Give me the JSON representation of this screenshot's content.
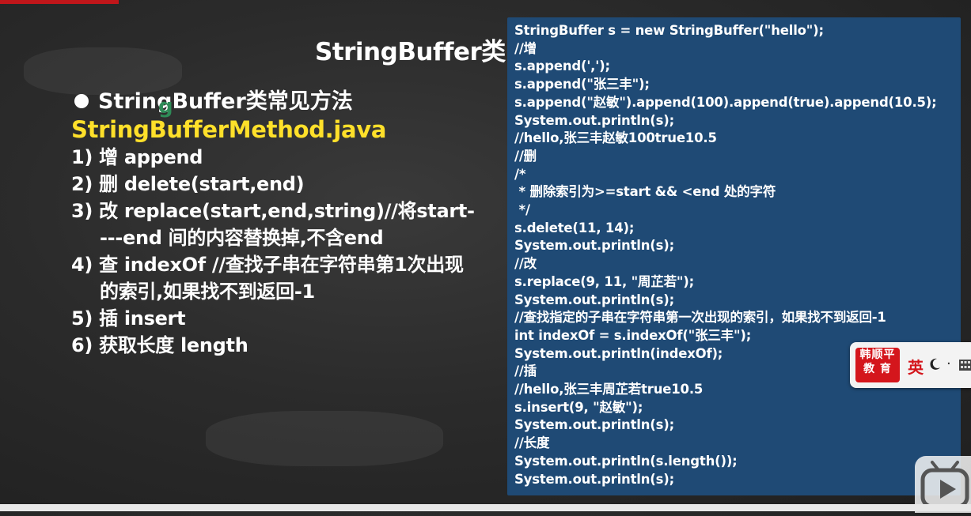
{
  "slide": {
    "title": "StringBuffer类",
    "bullet": "StringBuffer类常见方法",
    "filename": "StringBufferMethod.java",
    "methods": [
      "1) 增 append",
      "2) 删 delete(start,end)",
      "3) 改 replace(start,end,string)//将start----end 间的内容替换掉,不含end",
      "4) 查 indexOf //查找子串在字符串第1次出现的索引,如果找不到返回-1",
      "5) 插 insert",
      "6) 获取长度 length"
    ]
  },
  "code": {
    "lines": [
      "StringBuffer s = new StringBuffer(\"hello\");",
      "//增",
      "s.append(',');",
      "s.append(\"张三丰\");",
      "s.append(\"赵敏\").append(100).append(true).append(10.5);",
      "System.out.println(s);",
      "//hello,张三丰赵敏100true10.5",
      "//删",
      "/*",
      " * 删除索引为>=start && <end 处的字符",
      " */",
      "s.delete(11, 14);",
      "System.out.println(s);",
      "//改",
      "s.replace(9, 11, \"周芷若\");",
      "System.out.println(s);",
      "//查找指定的子串在字符串第一次出现的索引，如果找不到返回-1",
      "int indexOf = s.indexOf(\"张三丰\");",
      "System.out.println(indexOf);",
      "//插",
      "//hello,张三丰周芷若true10.5",
      "s.insert(9, \"赵敏\");",
      "System.out.println(s);",
      "//长度",
      "System.out.println(s.length());",
      "System.out.println(s);"
    ]
  },
  "overlay": {
    "logo_line1": "韩顺平",
    "logo_line2": "教 育",
    "ime_lang": "英",
    "ime_punct": "·",
    "cursor_glyph": "g",
    "colors": {
      "background": "#2b2b2b",
      "code_panel": "#1f4a75",
      "filename": "#ffe02a",
      "logo_red": "#d4161c"
    }
  }
}
